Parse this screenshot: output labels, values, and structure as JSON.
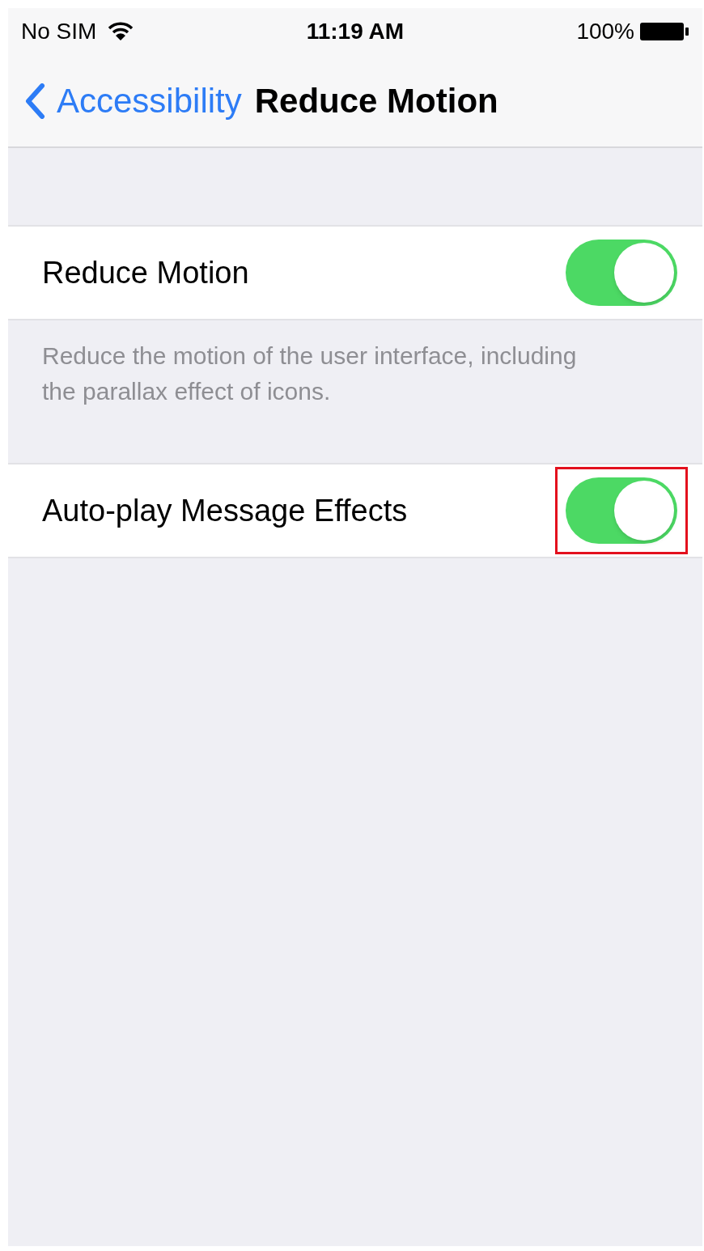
{
  "status_bar": {
    "carrier": "No SIM",
    "time": "11:19 AM",
    "battery": "100%"
  },
  "nav": {
    "back": "Accessibility",
    "title": "Reduce Motion"
  },
  "rows": [
    {
      "label": "Reduce Motion",
      "on": true,
      "highlighted": false,
      "footer": "Reduce the motion of the user interface, including the parallax effect of icons."
    },
    {
      "label": "Auto-play Message Effects",
      "on": true,
      "highlighted": true
    }
  ]
}
